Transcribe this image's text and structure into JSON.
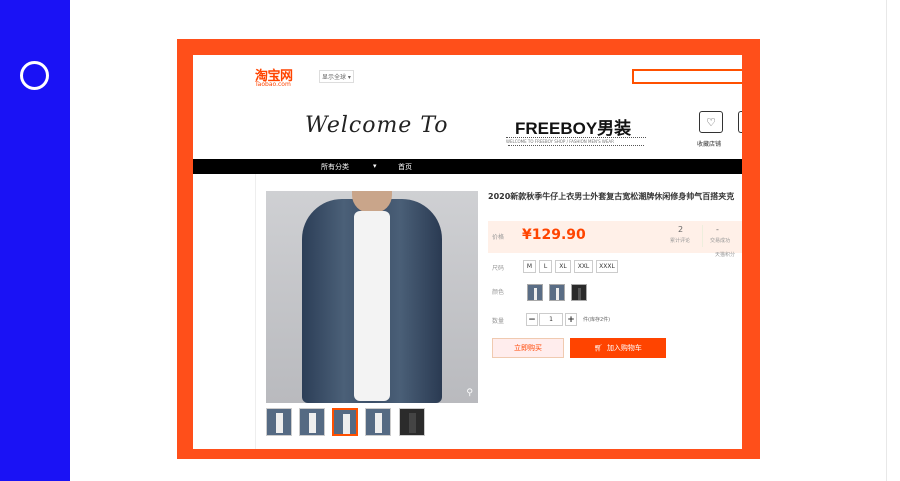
{
  "slide": {
    "accent_color": "#1a12f5",
    "frame_color": "#ff4f1a"
  },
  "header": {
    "logo_text": "淘宝网",
    "logo_subtext": "Taobao.com",
    "region_selector": "显示全球 ▾"
  },
  "banner": {
    "welcome_text": "Welcome To",
    "shop_name": "FREEBOY男装",
    "shop_tagline": "WELCOME TO FREEBOY SHOP / FASHION MEN'S WEAR",
    "favorite_label": "收藏店铺"
  },
  "nav": {
    "items": [
      "所有分类",
      "▾",
      "首页"
    ]
  },
  "product": {
    "title": "2020新款秋季牛仔上衣男士外套复古宽松潮牌休闲修身帅气百搭夹克",
    "price_label": "价格",
    "price": "¥129.90",
    "sales_count": "2",
    "sales_label": "累计评论",
    "reviews_count": "-",
    "reviews_label": "交易成功",
    "side_note": "天猫积分",
    "size_label": "尺码",
    "sizes": [
      "M",
      "L",
      "XL",
      "XXL",
      "XXXL"
    ],
    "color_label": "颜色",
    "quantity_label": "数量",
    "quantity_value": "1",
    "stock_text": "件(库存2件)",
    "buy_now_label": "立即购买",
    "add_to_cart_label": "加入购物车"
  }
}
